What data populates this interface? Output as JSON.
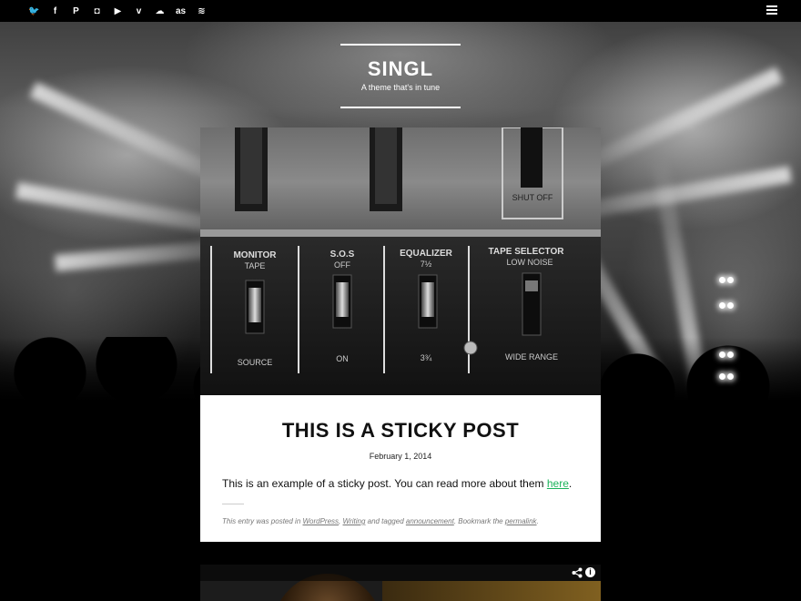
{
  "topbar": {
    "social": [
      {
        "name": "twitter-icon",
        "glyph": "🐦"
      },
      {
        "name": "facebook-icon",
        "glyph": "f"
      },
      {
        "name": "pinterest-icon",
        "glyph": "P"
      },
      {
        "name": "instagram-icon",
        "glyph": "◘"
      },
      {
        "name": "youtube-icon",
        "glyph": "▶"
      },
      {
        "name": "vimeo-icon",
        "glyph": "v"
      },
      {
        "name": "soundcloud-icon",
        "glyph": "☁"
      },
      {
        "name": "lastfm-icon",
        "glyph": "as"
      },
      {
        "name": "spotify-icon",
        "glyph": "≋"
      },
      {
        "name": "apple-icon",
        "glyph": ""
      }
    ],
    "menu_icon": "menu-icon"
  },
  "site": {
    "title": "SINGL",
    "tagline": "A theme that's in tune"
  },
  "post": {
    "image_labels": {
      "shutoff": "SHUT OFF",
      "monitor": "MONITOR",
      "tape": "TAPE",
      "source": "SOURCE",
      "sos": "S.O.S",
      "off": "OFF",
      "on": "ON",
      "equalizer": "EQUALIZER",
      "eq_top": "7½",
      "eq_bottom": "3¾",
      "tape_selector": "TAPE SELECTOR",
      "low_noise": "LOW NOISE",
      "wide_range": "WIDE RANGE"
    },
    "title": "THIS IS A STICKY POST",
    "date": "February 1, 2014",
    "excerpt_text": "This is an example of a sticky post. You can read more about them ",
    "excerpt_link": "here",
    "excerpt_end": ".",
    "meta": {
      "prefix": "This entry was posted in ",
      "cat1": "WordPress",
      "sep": ", ",
      "cat2": "Writing",
      "tagged": " and tagged ",
      "tag": "announcement",
      "bookmark": ". Bookmark the ",
      "permalink": "permalink",
      "end": "."
    }
  },
  "next_post": {
    "share_icon": "share-icon",
    "info_icon": "info-icon",
    "info_glyph": "i"
  }
}
